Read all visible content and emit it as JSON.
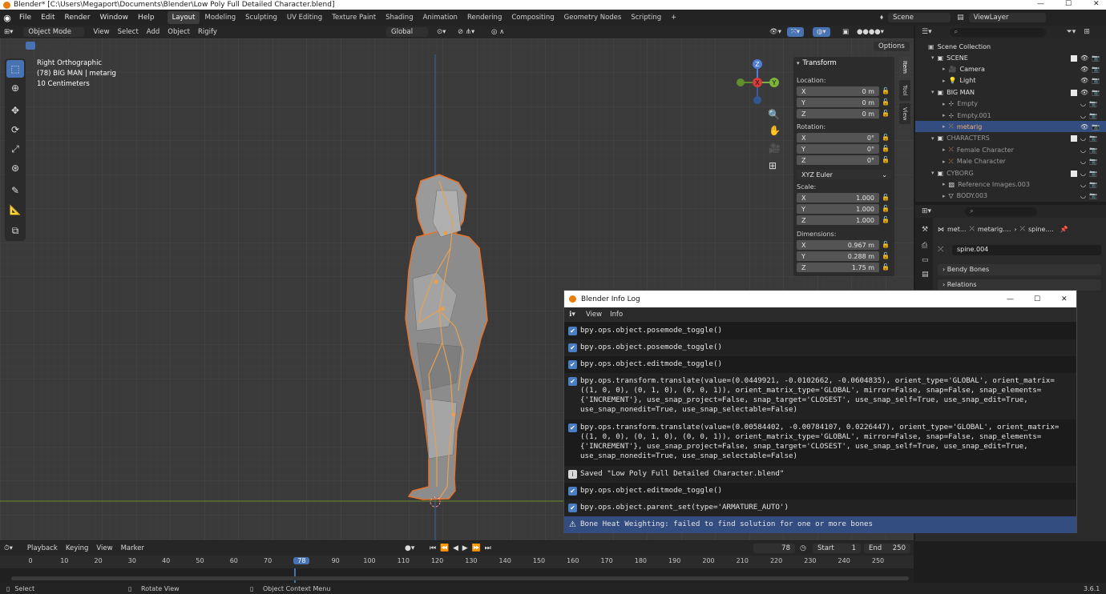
{
  "title_bar": {
    "text": "Blender* [C:\\Users\\Megaport\\Documents\\Blender\\Low Poly Full Detailed Character.blend]"
  },
  "menu": [
    "File",
    "Edit",
    "Render",
    "Window",
    "Help"
  ],
  "workspaces": [
    "Layout",
    "Modeling",
    "Sculpting",
    "UV Editing",
    "Texture Paint",
    "Shading",
    "Animation",
    "Rendering",
    "Compositing",
    "Geometry Nodes",
    "Scripting",
    "+"
  ],
  "active_workspace": "Layout",
  "scene": {
    "name": "Scene",
    "view_layer": "ViewLayer"
  },
  "viewport_header": {
    "mode": "Object Mode",
    "menus": [
      "View",
      "Select",
      "Add",
      "Object",
      "Rigify"
    ],
    "orientation": "Global",
    "options": "Options"
  },
  "viewport_info": {
    "line1": "Right Orthographic",
    "line2": "(78) BIG MAN | metarig",
    "line3": "10 Centimeters"
  },
  "gizmo": {
    "z": "Z",
    "x": "X",
    "y": "Y"
  },
  "n_panel": {
    "header": "Transform",
    "location_label": "Location:",
    "location": [
      {
        "axis": "X",
        "value": "0 m"
      },
      {
        "axis": "Y",
        "value": "0 m"
      },
      {
        "axis": "Z",
        "value": "0 m"
      }
    ],
    "rotation_label": "Rotation:",
    "rotation": [
      {
        "axis": "X",
        "value": "0°"
      },
      {
        "axis": "Y",
        "value": "0°"
      },
      {
        "axis": "Z",
        "value": "0°"
      }
    ],
    "rotation_mode": "XYZ Euler",
    "scale_label": "Scale:",
    "scale": [
      {
        "axis": "X",
        "value": "1.000"
      },
      {
        "axis": "Y",
        "value": "1.000"
      },
      {
        "axis": "Z",
        "value": "1.000"
      }
    ],
    "dimensions_label": "Dimensions:",
    "dimensions": [
      {
        "axis": "X",
        "value": "0.967 m"
      },
      {
        "axis": "Y",
        "value": "0.288 m"
      },
      {
        "axis": "Z",
        "value": "1.75 m"
      }
    ],
    "tabs": [
      "Item",
      "Tool",
      "View"
    ]
  },
  "outliner": {
    "root": "Scene Collection",
    "rows": [
      {
        "label": "SCENE",
        "depth": 1,
        "kind": "collection"
      },
      {
        "label": "Camera",
        "depth": 2,
        "kind": "camera"
      },
      {
        "label": "Light",
        "depth": 2,
        "kind": "light"
      },
      {
        "label": "BIG MAN",
        "depth": 1,
        "kind": "collection"
      },
      {
        "label": "Empty",
        "depth": 2,
        "kind": "empty",
        "dim": true
      },
      {
        "label": "Empty.001",
        "depth": 2,
        "kind": "empty",
        "dim": true
      },
      {
        "label": "metarig",
        "depth": 2,
        "kind": "armature",
        "selected": true
      },
      {
        "label": "CHARACTERS",
        "depth": 1,
        "kind": "collection",
        "dim": true
      },
      {
        "label": "Female Character",
        "depth": 2,
        "kind": "armature",
        "dim": true
      },
      {
        "label": "Male Character",
        "depth": 2,
        "kind": "armature",
        "dim": true
      },
      {
        "label": "CYBORG",
        "depth": 1,
        "kind": "collection",
        "dim": true
      },
      {
        "label": "Reference Images.003",
        "depth": 2,
        "kind": "image",
        "dim": true
      },
      {
        "label": "BODY.003",
        "depth": 2,
        "kind": "mesh",
        "dim": true
      }
    ]
  },
  "properties": {
    "breadcrumb": [
      "met...",
      "metarig....",
      "spine...."
    ],
    "bone_name": "spine.004",
    "sections": [
      "Bendy Bones",
      "Relations"
    ]
  },
  "info_log": {
    "title": "Blender Info Log",
    "menus": [
      "View",
      "Info"
    ],
    "entries": [
      {
        "type": "op",
        "text": "bpy.ops.object.posemode_toggle()"
      },
      {
        "type": "op",
        "text": "bpy.ops.object.posemode_toggle()"
      },
      {
        "type": "op",
        "text": "bpy.ops.object.editmode_toggle()"
      },
      {
        "type": "op",
        "text": "bpy.ops.transform.translate(value=(0.0449921, -0.0102662, -0.0604835), orient_type='GLOBAL', orient_matrix=((1, 0, 0), (0, 1, 0), (0, 0, 1)), orient_matrix_type='GLOBAL', mirror=False, snap=False, snap_elements={'INCREMENT'}, use_snap_project=False, snap_target='CLOSEST', use_snap_self=True, use_snap_edit=True, use_snap_nonedit=True, use_snap_selectable=False)"
      },
      {
        "type": "op",
        "text": "bpy.ops.transform.translate(value=(0.00584402, -0.00784107, 0.0226447), orient_type='GLOBAL', orient_matrix=((1, 0, 0), (0, 1, 0), (0, 0, 1)), orient_matrix_type='GLOBAL', mirror=False, snap=False, snap_elements={'INCREMENT'}, use_snap_project=False, snap_target='CLOSEST', use_snap_self=True, use_snap_edit=True, use_snap_nonedit=True, use_snap_selectable=False)"
      },
      {
        "type": "info",
        "text": "Saved \"Low Poly Full Detailed Character.blend\""
      },
      {
        "type": "op",
        "text": "bpy.ops.object.editmode_toggle()"
      },
      {
        "type": "op",
        "text": "bpy.ops.object.parent_set(type='ARMATURE_AUTO')"
      },
      {
        "type": "warning",
        "text": "Bone Heat Weighting: failed to find solution for one or more bones"
      }
    ]
  },
  "timeline": {
    "menus": [
      "Playback",
      "Keying",
      "View",
      "Marker"
    ],
    "current_frame": "78",
    "start_label": "Start",
    "start": "1",
    "end_label": "End",
    "end": "250",
    "ruler": [
      "0",
      "10",
      "20",
      "30",
      "40",
      "50",
      "60",
      "70",
      "78",
      "90",
      "100",
      "110",
      "120",
      "130",
      "140",
      "150",
      "160",
      "170",
      "180",
      "190",
      "200",
      "210",
      "220",
      "230",
      "240",
      "250"
    ]
  },
  "status_bar": {
    "items": [
      "Select",
      "Rotate View",
      "Object Context Menu"
    ],
    "version": "3.6.1"
  },
  "colors": {
    "accent": "#4772b3",
    "selection_outline": "#e8732b",
    "warning_row": "#334d80"
  }
}
